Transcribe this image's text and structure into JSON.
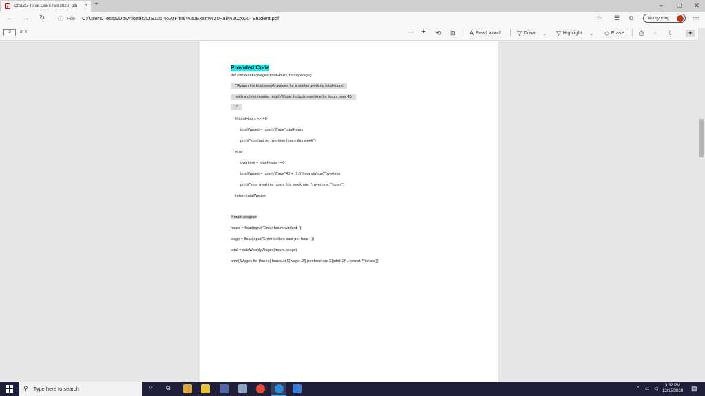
{
  "browser": {
    "tab_title": "CIS125- Final Exam Fall 2020_Stu...",
    "tab_close": "×",
    "new_tab": "+",
    "window_minimize": "–",
    "window_restore": "❐",
    "window_close": "✕",
    "address_scheme": "File",
    "address_path": "C:/Users/Tessa/Downloads/CIS125 %20Final%20Exam%20Fall%202020_Student.pdf",
    "sync_label": "Not syncing",
    "more": "···"
  },
  "pdf_toolbar": {
    "page_current": "3",
    "page_total": "of 8",
    "zoom_out": "—",
    "zoom_in": "+",
    "read_aloud": "Read aloud",
    "draw": "Draw",
    "highlight": "Highlight",
    "erase": "Erase"
  },
  "document": {
    "heading": "Provided Code",
    "lines": [
      "def calcWeeklyWages(totalHours, hourlyWage):",
      "'''Return the total weekly wages for a worker working totalHours,",
      "with a given regular hourlyWage.  Include overtime for hours over 40.",
      "'''",
      "if totalHours <= 40:",
      "totalWages = hourlyWage*totalHours",
      "print(\"you had no overtime hours this week\")",
      "else:",
      "overtime = totalHours - 40",
      "totalWages = hourlyWage*40 + (1.5*hourlyWage)*overtime",
      "print(\"your overtime hours this week are: \", overtime, \"hours\")",
      "return totalWages",
      "# main program",
      "hours = float(input('Enter hours worked: '))",
      "wage = float(input('Enter dollars paid per hour: '))",
      "total = calcWeeklyWages(hours, wage)",
      "print('Wages for {hours} hours at ${wage:.2f} per hour are ${total:.2f}.'.format(**locals()))"
    ]
  },
  "taskbar": {
    "search_placeholder": "Type here to search",
    "time": "3:32 PM",
    "date": "12/15/2020"
  },
  "colors": {
    "heading_highlight": "#00f0f0",
    "code_highlight": "#dcdcdc",
    "taskbar": "#1f1f3a"
  }
}
